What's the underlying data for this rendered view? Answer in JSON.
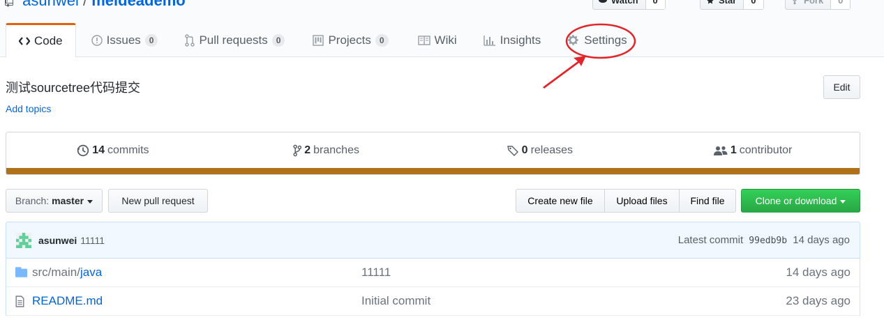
{
  "repo": {
    "owner": "asunwei",
    "separator": "/",
    "name": "meideademo"
  },
  "actions": [
    {
      "label": "Watch",
      "count": "0"
    },
    {
      "label": "Star",
      "count": "0"
    },
    {
      "label": "Fork",
      "count": "0"
    }
  ],
  "tabs": [
    {
      "label": "Code",
      "icon": "code-icon",
      "selected": true
    },
    {
      "label": "Issues",
      "icon": "issue-icon",
      "count": "0"
    },
    {
      "label": "Pull requests",
      "icon": "pull-request-icon",
      "count": "0"
    },
    {
      "label": "Projects",
      "icon": "project-icon",
      "count": "0"
    },
    {
      "label": "Wiki",
      "icon": "book-icon"
    },
    {
      "label": "Insights",
      "icon": "graph-icon"
    },
    {
      "label": "Settings",
      "icon": "gear-icon",
      "annotated": true
    }
  ],
  "annotation": {
    "color": "#e0262b"
  },
  "description": {
    "text": "测试sourcetree代码提交",
    "add_topics": "Add topics",
    "edit_label": "Edit"
  },
  "summary": {
    "commits": {
      "count": "14",
      "label": "commits"
    },
    "branches": {
      "count": "2",
      "label": "branches"
    },
    "releases": {
      "count": "0",
      "label": "releases"
    },
    "contributors": {
      "count": "1",
      "label": "contributor"
    },
    "language_color": "#b07219"
  },
  "file_nav": {
    "branch_prefix": "Branch:",
    "branch_name": "master",
    "new_pr": "New pull request",
    "create_file": "Create new file",
    "upload_files": "Upload files",
    "find_file": "Find file",
    "clone": "Clone or download",
    "clone_color": "#28a745"
  },
  "latest_commit": {
    "author": "asunwei",
    "message": "11111",
    "prefix": "Latest commit",
    "sha": "99edb9b",
    "age": "14 days ago"
  },
  "files": [
    {
      "icon": "folder-icon",
      "path_muted": "src/main/",
      "path": "java",
      "message": "11111",
      "age": "14 days ago"
    },
    {
      "icon": "file-icon",
      "path_muted": "",
      "path": "README.md",
      "message": "Initial commit",
      "age": "23 days ago"
    }
  ]
}
